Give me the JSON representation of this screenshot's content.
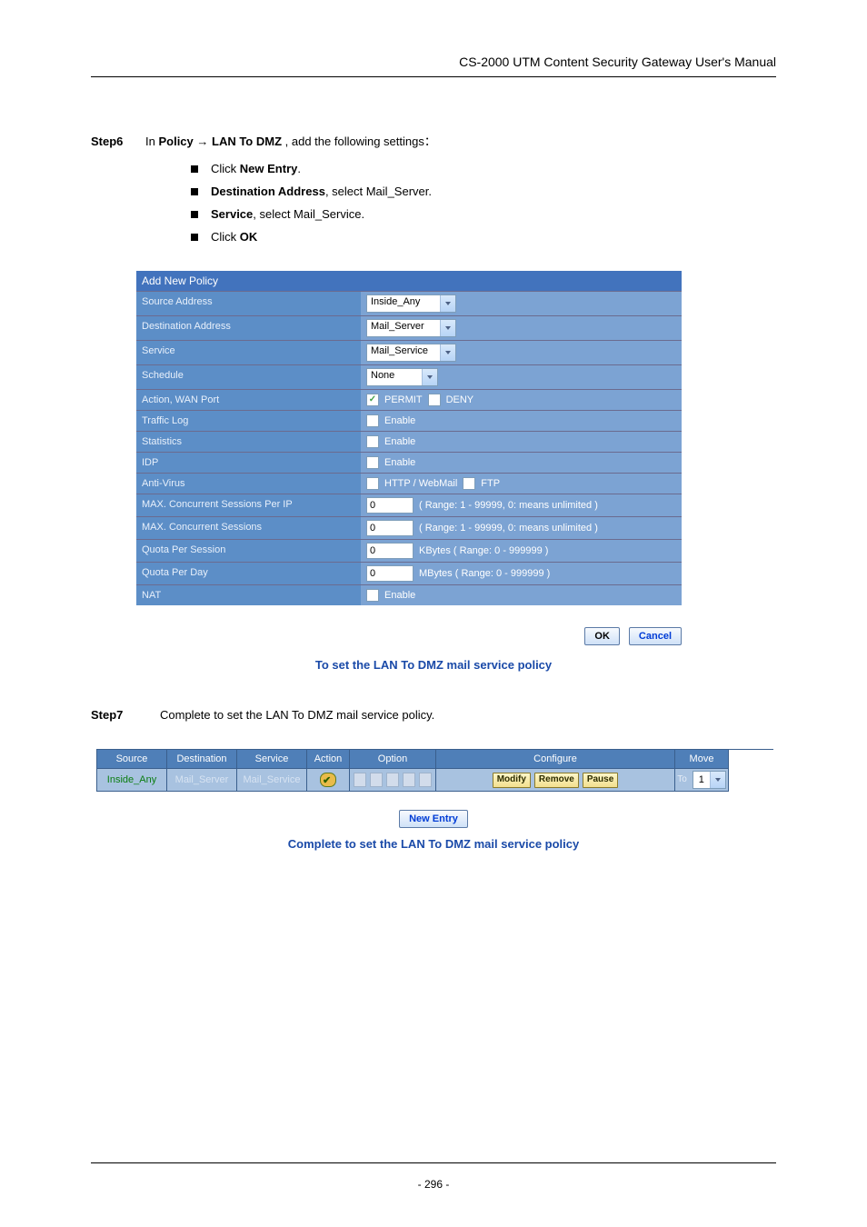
{
  "header": "CS-2000 UTM Content Security Gateway User's Manual",
  "step6": {
    "label": "Step6",
    "text_prefix": "In ",
    "policy": "Policy",
    "arrow": " → ",
    "lan_to_dmz": "LAN To DMZ",
    "text_suffix": " , add the following settings：",
    "bullets": [
      {
        "pre": "Click ",
        "bold": "New Entry",
        "post": "."
      },
      {
        "pre": "",
        "bold": "Destination Address",
        "post": ", select Mail_Server."
      },
      {
        "pre": "",
        "bold": "Service",
        "post": ", select Mail_Service."
      },
      {
        "pre": "Click ",
        "bold": "OK",
        "post": ""
      }
    ]
  },
  "form": {
    "title": "Add New Policy",
    "rows": {
      "source_address": {
        "label": "Source Address",
        "value": "Inside_Any"
      },
      "destination_address": {
        "label": "Destination Address",
        "value": "Mail_Server"
      },
      "service": {
        "label": "Service",
        "value": "Mail_Service"
      },
      "schedule": {
        "label": "Schedule",
        "value": "None"
      },
      "action_wan": {
        "label": "Action, WAN Port",
        "permit": "PERMIT",
        "deny": "DENY",
        "permit_checked": true,
        "deny_checked": false
      },
      "traffic_log": {
        "label": "Traffic Log",
        "text": "Enable",
        "checked": false
      },
      "statistics": {
        "label": "Statistics",
        "text": "Enable",
        "checked": false
      },
      "idp": {
        "label": "IDP",
        "text": "Enable",
        "checked": false
      },
      "antivirus": {
        "label": "Anti-Virus",
        "http": "HTTP / WebMail",
        "ftp": "FTP",
        "http_checked": false,
        "ftp_checked": false
      },
      "max_sess_ip": {
        "label": "MAX. Concurrent Sessions Per IP",
        "value": "0",
        "hint": "( Range: 1 - 99999, 0: means unlimited )"
      },
      "max_sess": {
        "label": "MAX. Concurrent Sessions",
        "value": "0",
        "hint": "( Range: 1 - 99999, 0: means unlimited )"
      },
      "quota_sess": {
        "label": "Quota Per Session",
        "value": "0",
        "hint": "KBytes  ( Range: 0 - 999999 )"
      },
      "quota_day": {
        "label": "Quota Per Day",
        "value": "0",
        "hint": "MBytes  ( Range: 0 - 999999 )"
      },
      "nat": {
        "label": "NAT",
        "text": "Enable",
        "checked": false
      }
    },
    "ok": "OK",
    "cancel": "Cancel"
  },
  "caption1": "To set the LAN To DMZ mail service policy",
  "step7": {
    "label": "Step7",
    "text": "Complete to set the LAN To DMZ mail service policy."
  },
  "ptable": {
    "headers": {
      "source": "Source",
      "destination": "Destination",
      "service": "Service",
      "action": "Action",
      "option": "Option",
      "configure": "Configure",
      "move": "Move"
    },
    "row": {
      "source": "Inside_Any",
      "destination": "Mail_Server",
      "service": "Mail_Service",
      "modify": "Modify",
      "remove": "Remove",
      "pause": "Pause",
      "move_to": "To",
      "move_val": "1"
    }
  },
  "new_entry": "New Entry",
  "caption2": "Complete to set the LAN To DMZ mail service policy",
  "page_number": "- 296 -"
}
